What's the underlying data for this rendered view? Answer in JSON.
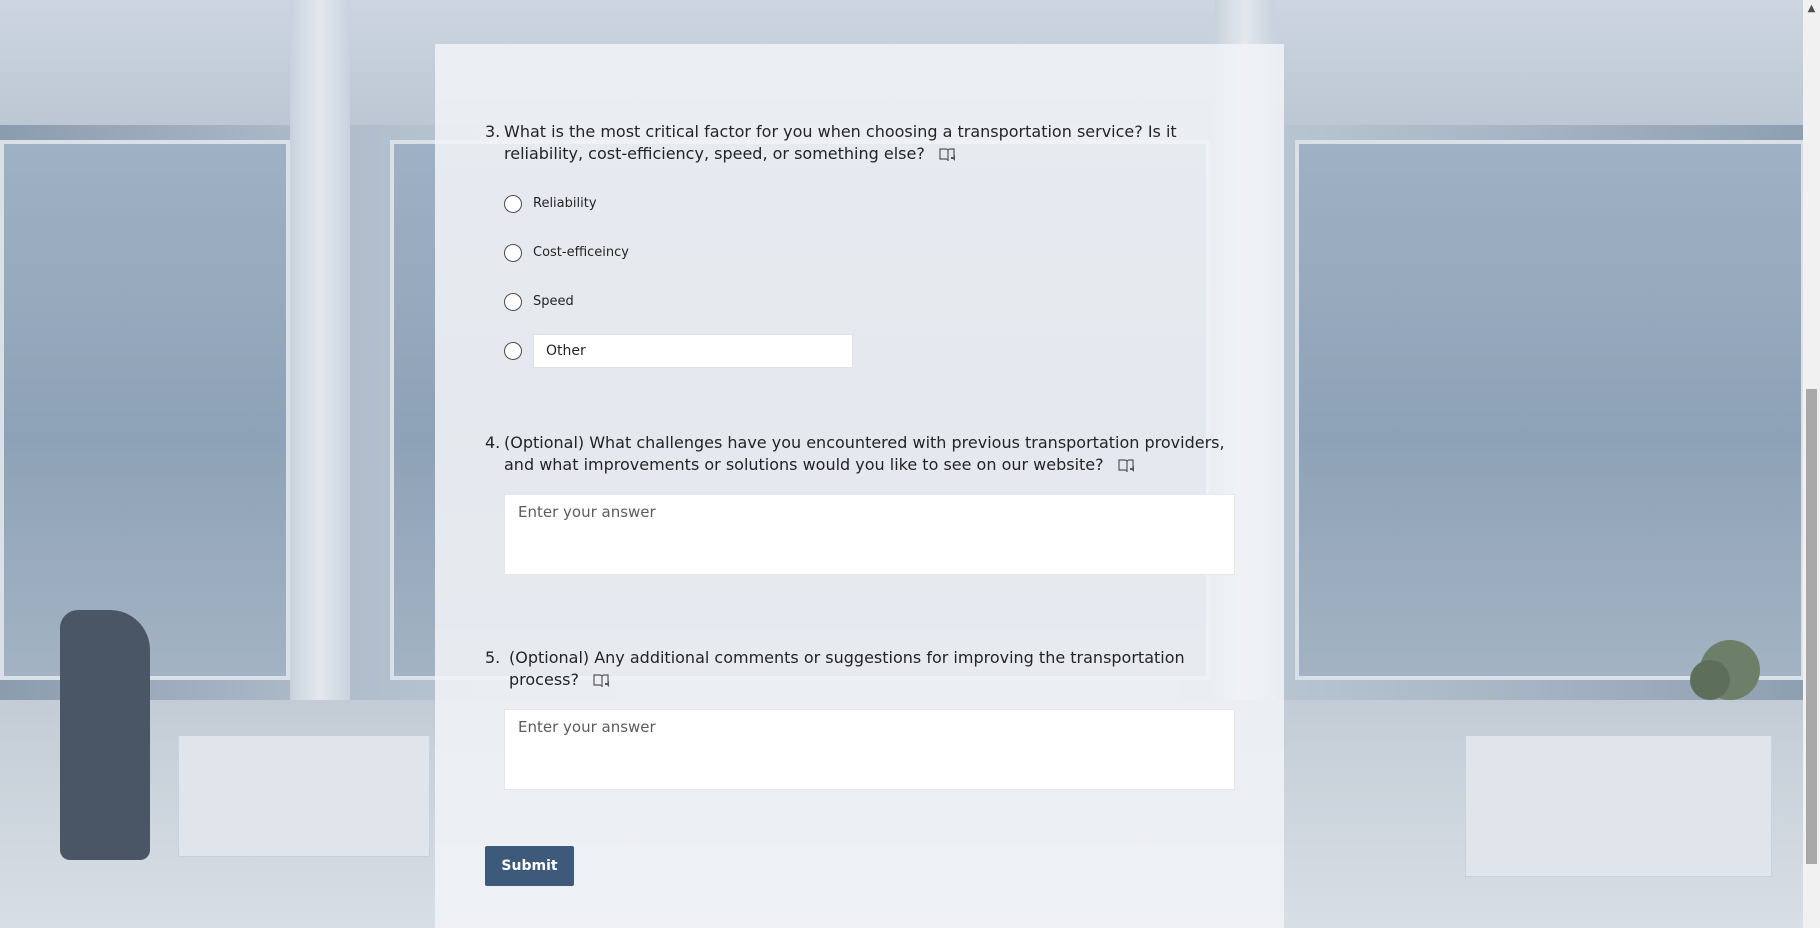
{
  "questions": [
    {
      "number": "3.",
      "text": "What is the most critical factor for you when choosing a transportation service? Is it reliability, cost-efficiency, speed, or something else?",
      "options": [
        "Reliability",
        "Cost-efficeincy",
        "Speed"
      ],
      "other_placeholder": "Other"
    },
    {
      "number": "4.",
      "text": "(Optional) What challenges have you encountered with previous transportation providers, and what improvements or solutions would you like to see on our website?",
      "answer_placeholder": "Enter your answer"
    },
    {
      "number": "5.",
      "text": "(Optional) Any additional comments or suggestions for improving the transportation process?",
      "answer_placeholder": "Enter your answer"
    }
  ],
  "submit_label": "Submit",
  "icons": {
    "reader": "immersive-reader-icon",
    "scroll_up": "scroll-up-arrow-icon"
  },
  "colors": {
    "submit_bg": "#3e5a7a",
    "card_bg": "#f0f3f6"
  }
}
